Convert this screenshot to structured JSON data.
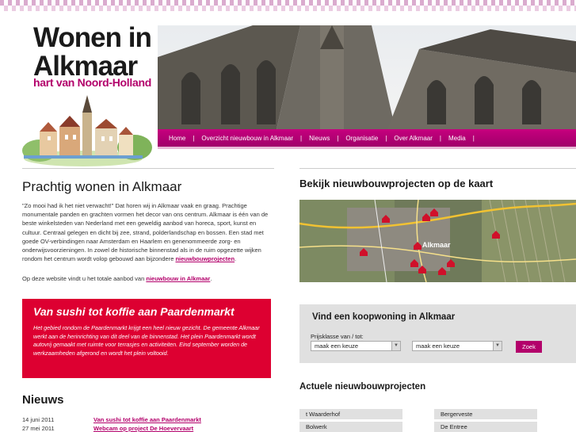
{
  "logo": {
    "title_line1": "Wonen in",
    "title_line2": "Alkmaar",
    "subtitle": "hart van Noord-Holland"
  },
  "nav": {
    "items": [
      {
        "label": "Home"
      },
      {
        "label": "Overzicht nieuwbouw in Alkmaar"
      },
      {
        "label": "Nieuws"
      },
      {
        "label": "Organisatie"
      },
      {
        "label": "Over Alkmaar"
      },
      {
        "label": "Media"
      }
    ],
    "separator": "|"
  },
  "intro": {
    "title": "Prachtig wonen in Alkmaar",
    "text": "\"Zo mooi had ik het niet verwacht!\" Dat horen wij in Alkmaar vaak en graag. Prachtige monumentale panden en grachten vormen het decor van ons centrum. Alkmaar is één van de beste winkelsteden van Nederland met een geweldig aanbod van horeca, sport, kunst en cultuur. Centraal gelegen en dicht bij zee, strand, polderlandschap en bossen. Een stad met goede OV-verbindingen naar Amsterdam en Haarlem en genenommeerde zorg- en onderwijsvoorzieningen. In zowel de historische binnenstad als in de ruim opgezette wijken rondom het centrum wordt volop gebouwd aan bijzondere ",
    "text_link": "nieuwbouwprojecten",
    "text_end": ".",
    "text2": "Op deze website vindt u het totale aanbod van ",
    "text2_link": "nieuwbouw in Alkmaar",
    "text2_end": "."
  },
  "promo": {
    "title": "Van sushi tot koffie aan Paardenmarkt",
    "text": "Het gebied rondom de Paardenmarkt krijgt een heel nieuw gezicht. De gemeente Alkmaar werkt aan de herinrichting van dit deel van de binnenstad. Het plein Paardenmarkt wordt autovrij gemaakt met ruimte voor terrasjes en activiteiten. Eind september worden de werkzaamheden afgerond en wordt het plein voltooid."
  },
  "news": {
    "title": "Nieuws",
    "items": [
      {
        "date": "14 juni 2011",
        "title": "Van sushi tot koffie aan Paardenmarkt"
      },
      {
        "date": "27 mei 2011",
        "title": "Webcam op project De Hoevervaart"
      }
    ]
  },
  "map": {
    "title": "Bekijk nieuwbouwprojecten op de kaart",
    "place_label": "Alkmaar"
  },
  "search": {
    "title": "Vind een koopwoning in Alkmaar",
    "label": "Prijsklasse van / tot:",
    "from_value": "maak een keuze",
    "to_value": "maak een keuze",
    "button": "Zoek"
  },
  "projects": {
    "title": "Actuele nieuwbouwprojecten",
    "items": [
      {
        "label": "t Waarderhof"
      },
      {
        "label": "Bergerveste"
      },
      {
        "label": "Bolwerk"
      },
      {
        "label": "De Entree"
      }
    ]
  },
  "colors": {
    "brand": "#b3006b",
    "nav": "#c6007e",
    "promo": "#dd0031",
    "panel": "#e0e0e0"
  }
}
